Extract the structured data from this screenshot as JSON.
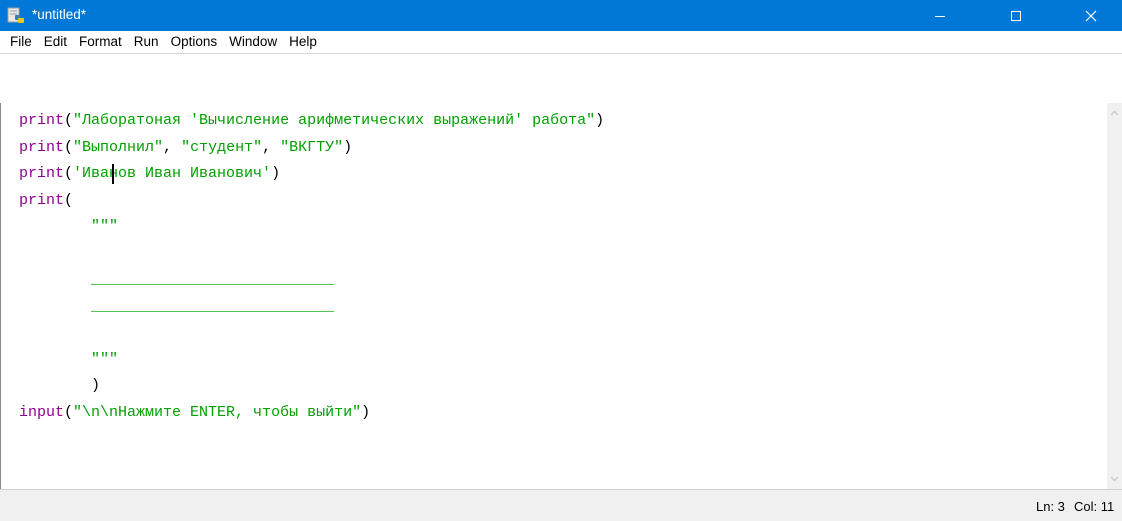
{
  "window": {
    "title": "*untitled*",
    "icon": "python-idle-icon",
    "accent": "#0078d7"
  },
  "menu": {
    "items": [
      {
        "label": "File"
      },
      {
        "label": "Edit"
      },
      {
        "label": "Format"
      },
      {
        "label": "Run"
      },
      {
        "label": "Options"
      },
      {
        "label": "Window"
      },
      {
        "label": "Help"
      }
    ]
  },
  "editor": {
    "colors": {
      "keyword": "#900090",
      "string": "#00a000",
      "plain": "#000000"
    },
    "lines": [
      [
        {
          "t": "print",
          "c": "kw"
        },
        {
          "t": "(",
          "c": "pl"
        },
        {
          "t": "\"Лаборатоная 'Вычисление арифметических выражений' работа\"",
          "c": "str"
        },
        {
          "t": ")",
          "c": "pl"
        }
      ],
      [
        {
          "t": "print",
          "c": "kw"
        },
        {
          "t": "(",
          "c": "pl"
        },
        {
          "t": "\"Выполнил\"",
          "c": "str"
        },
        {
          "t": ", ",
          "c": "pl"
        },
        {
          "t": "\"студент\"",
          "c": "str"
        },
        {
          "t": ", ",
          "c": "pl"
        },
        {
          "t": "\"ВКГТУ\"",
          "c": "str"
        },
        {
          "t": ")",
          "c": "pl"
        }
      ],
      [
        {
          "t": "print",
          "c": "kw"
        },
        {
          "t": "(",
          "c": "pl"
        },
        {
          "t": "'Иванов Иван Иванович'",
          "c": "str"
        },
        {
          "t": ")",
          "c": "pl"
        }
      ],
      [
        {
          "t": "print",
          "c": "kw"
        },
        {
          "t": "(",
          "c": "pl"
        }
      ],
      [
        {
          "t": "        \"\"\"",
          "c": "str"
        }
      ],
      [
        {
          "t": "",
          "c": "pl"
        }
      ],
      [
        {
          "t": "        ___________________________",
          "c": "str"
        }
      ],
      [
        {
          "t": "        ___________________________",
          "c": "str"
        }
      ],
      [
        {
          "t": "",
          "c": "pl"
        }
      ],
      [
        {
          "t": "        \"\"\"",
          "c": "str"
        }
      ],
      [
        {
          "t": "        )",
          "c": "pl"
        }
      ],
      [
        {
          "t": "input",
          "c": "kw"
        },
        {
          "t": "(",
          "c": "pl"
        },
        {
          "t": "\"\\n\\nНажмите ENTER, чтобы выйти\"",
          "c": "str"
        },
        {
          "t": ")",
          "c": "pl"
        }
      ]
    ]
  },
  "status": {
    "ln": "Ln: 3",
    "col": "Col: 11"
  }
}
